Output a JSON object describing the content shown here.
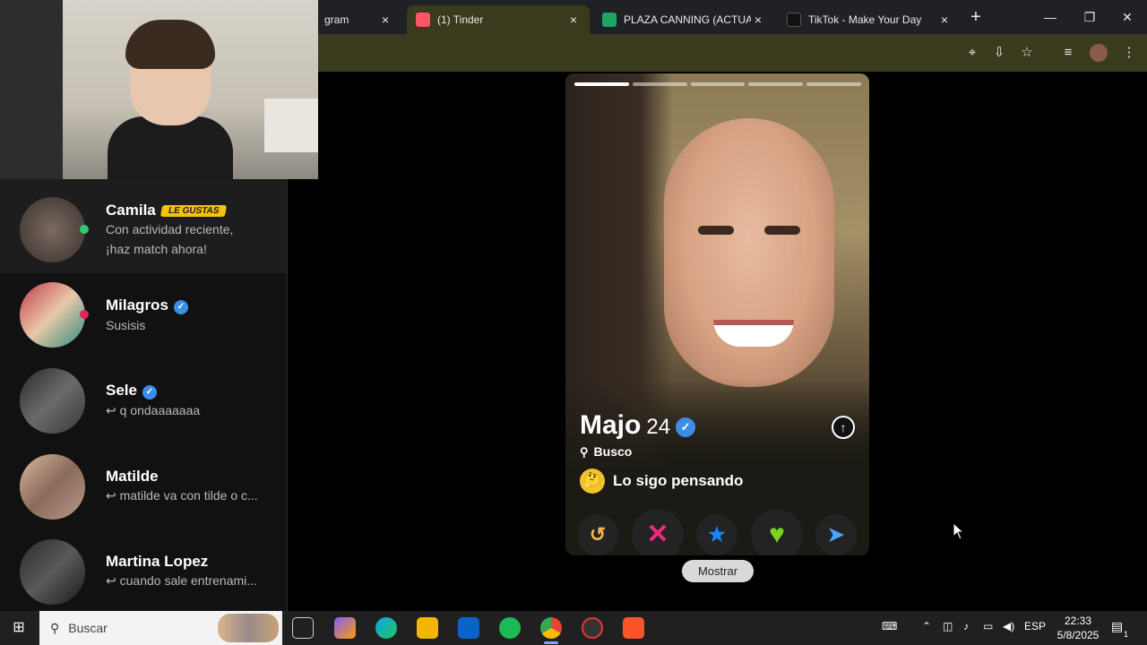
{
  "browser": {
    "tabs": [
      {
        "title": "gram",
        "active": false
      },
      {
        "title": "(1) Tinder",
        "active": true
      },
      {
        "title": "PLAZA CANNING (ACTUALIZ",
        "active": false
      },
      {
        "title": "TikTok - Make Your Day",
        "active": false
      }
    ],
    "close_glyph": "×",
    "new_tab_glyph": "+",
    "window_controls": {
      "minimize": "—",
      "maximize": "❐",
      "close": "✕"
    }
  },
  "sidebar": {
    "matches": [
      {
        "name": "Camila",
        "badge": "LE GUSTAS",
        "message": "Con actividad reciente,",
        "message2": "¡haz match ahora!",
        "verified": false,
        "online_color": "#2ecc71"
      },
      {
        "name": "Milagros",
        "message": "Susisis",
        "verified": true,
        "online_color": "#e0245e"
      },
      {
        "name": "Sele",
        "message": "↩ q ondaaaaaaa",
        "verified": true
      },
      {
        "name": "Matilde",
        "message": "↩ matilde va con tilde o c...",
        "verified": false
      },
      {
        "name": "Martina Lopez",
        "message": "↩ cuando sale entrenami...",
        "verified": false
      }
    ]
  },
  "profile": {
    "name": "Majo",
    "age": "24",
    "verified": true,
    "looking_label": "Busco",
    "intent_emoji": "🤔",
    "intent": "Lo sigo pensando",
    "photo_count": 5,
    "photo_index": 1
  },
  "actions": {
    "rewind": "↺",
    "nope": "✕",
    "super_like": "★",
    "like": "♥",
    "boost": "➤"
  },
  "tooltip": "Mostrar",
  "colors": {
    "accent": "#3a3a1c",
    "rewind": "#f5b748",
    "nope": "#fd267d",
    "super_like": "#1786ff",
    "like": "#7ed321",
    "boost": "#4ba3ff",
    "verified": "#3a8ee6",
    "badge": "#f4c20d"
  },
  "taskbar": {
    "search_placeholder": "Buscar",
    "language": "ESP",
    "time": "22:33",
    "date": "5/8/2025",
    "notifications": "1"
  }
}
